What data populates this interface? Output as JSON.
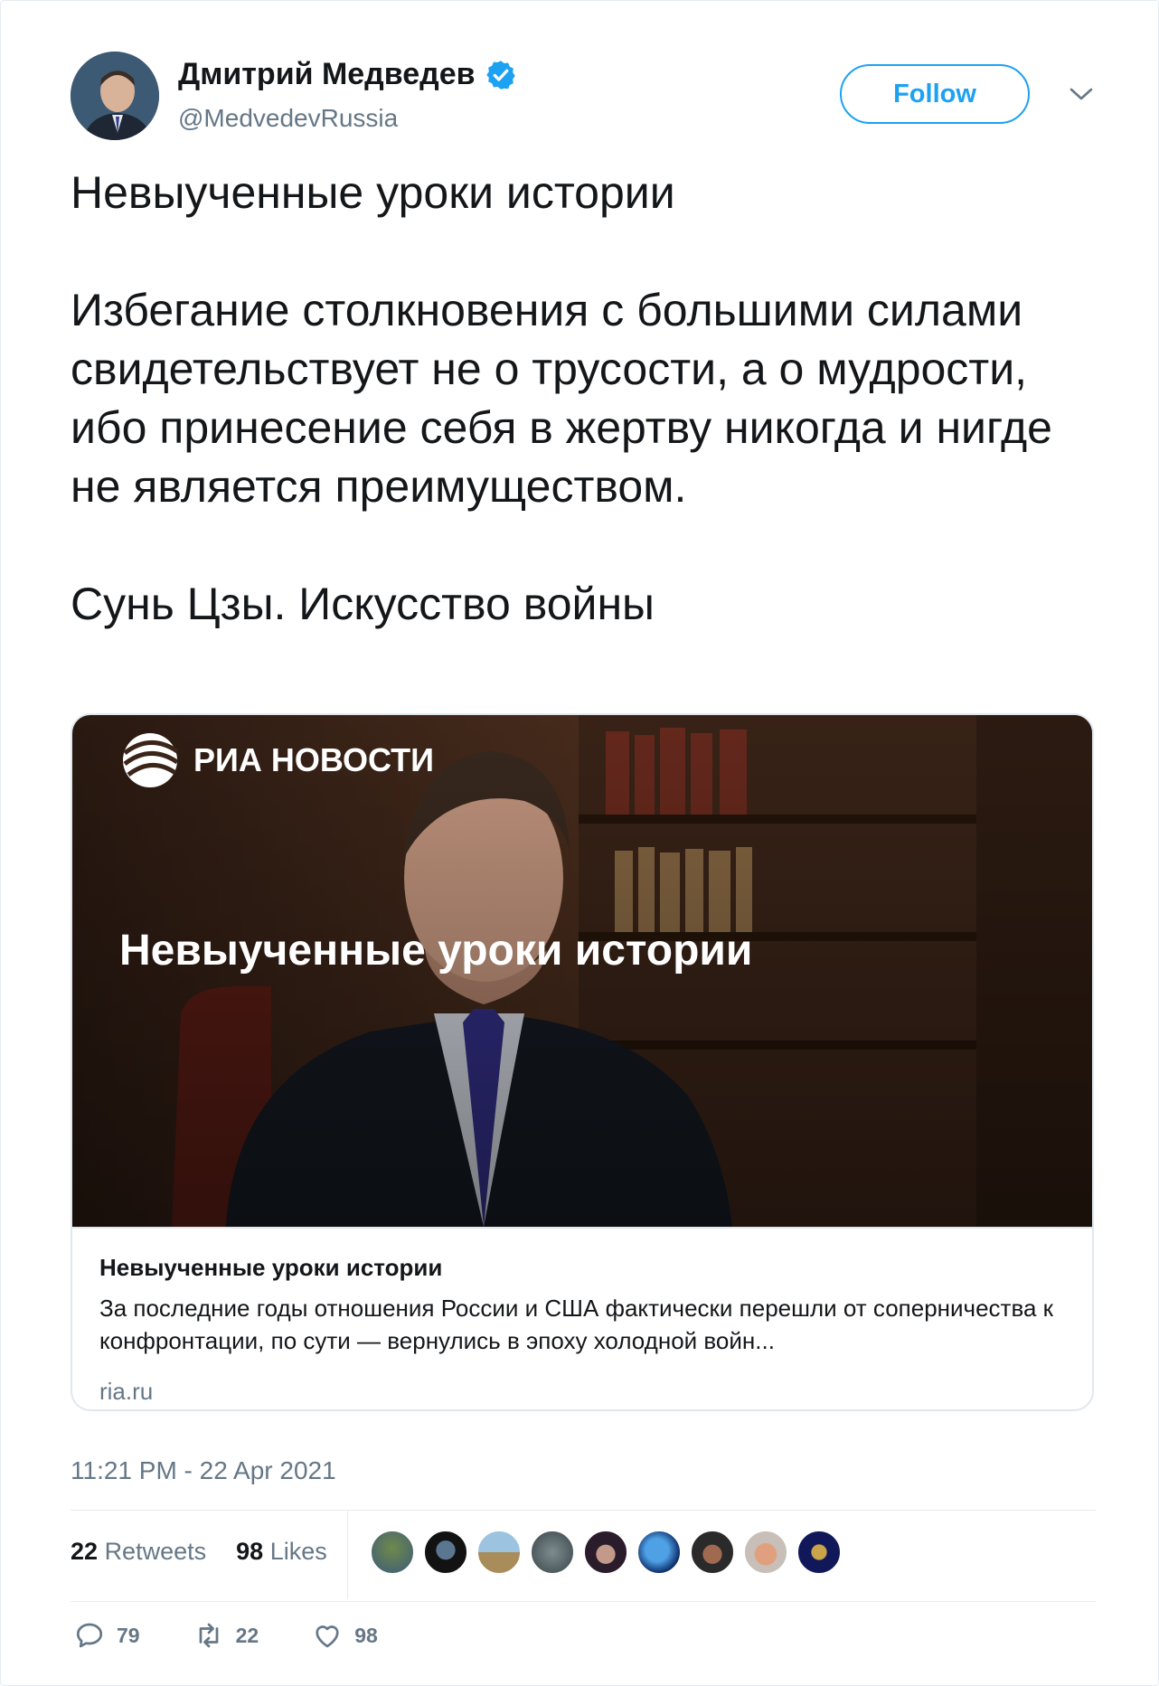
{
  "user": {
    "name": "Дмитрий Медведев",
    "handle": "@MedvedevRussia",
    "verified": true
  },
  "follow_label": "Follow",
  "tweet": {
    "paragraphs": [
      "Невыученные уроки истории",
      "Избегание столкновения с большими силами свидетельствует не о трусости, а о мудрости, ибо принесение себя в жертву никогда и нигде не является преимуществом.",
      "Сунь Цзы. Искусство войны"
    ]
  },
  "card": {
    "image_logo_text": "РИА НОВОСТИ",
    "image_headline": "Невыученные уроки истории",
    "title": "Невыученные уроки истории",
    "description": "За последние годы отношения России и США фактически перешли от соперничества к конфронтации, по сути — вернулись в эпоху холодной войн...",
    "domain": "ria.ru"
  },
  "timestamp": "11:21 PM - 22 Apr 2021",
  "stats": {
    "retweets_count": "22",
    "retweets_label": "Retweets",
    "likes_count": "98",
    "likes_label": "Likes"
  },
  "actions": {
    "replies": "79",
    "retweets": "22",
    "likes": "98"
  },
  "colors": {
    "brand_blue": "#1da1f2",
    "secondary_text": "#657786",
    "border": "#e1e8ed"
  }
}
